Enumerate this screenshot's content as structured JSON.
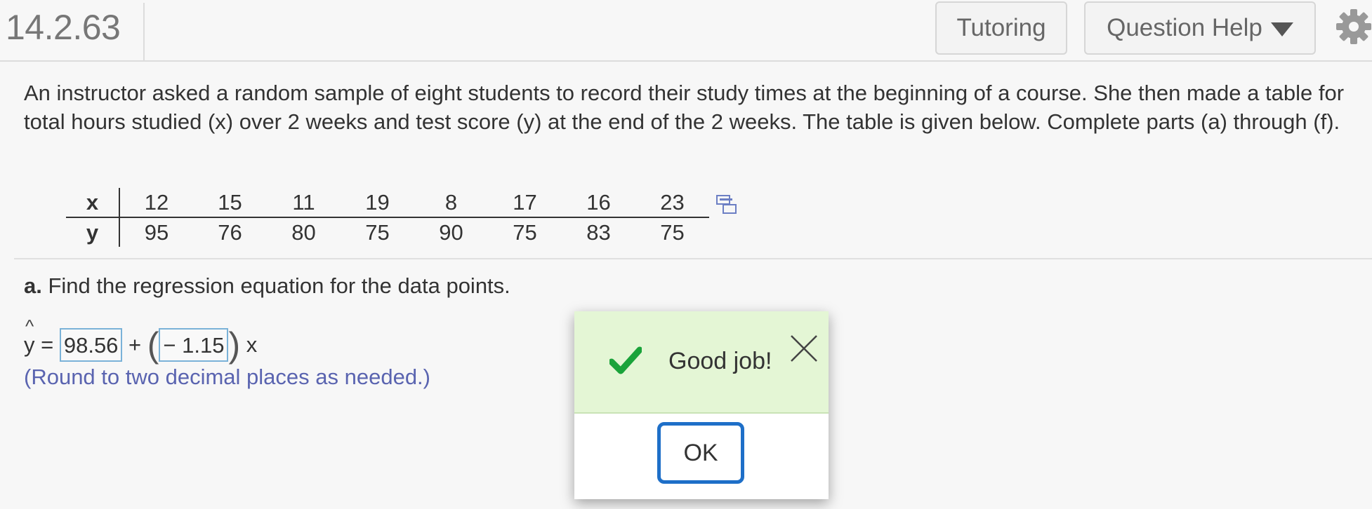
{
  "header": {
    "question_number": "14.2.63",
    "tutoring_label": "Tutoring",
    "question_help_label": "Question Help"
  },
  "problem": {
    "text": "An instructor asked a random sample of eight students to record their study times at the beginning of a course. She then made a table for total hours studied (x) over 2 weeks and test score (y) at the end of the 2 weeks. The table is given below. Complete parts (a) through (f)."
  },
  "table": {
    "x_label": "x",
    "y_label": "y",
    "x_values": [
      "12",
      "15",
      "11",
      "19",
      "8",
      "17",
      "16",
      "23"
    ],
    "y_values": [
      "95",
      "76",
      "80",
      "75",
      "90",
      "75",
      "83",
      "75"
    ]
  },
  "part_a": {
    "label": "a.",
    "prompt": " Find the regression equation for the data points.",
    "yhat_symbol": "y",
    "hat_mark": "^",
    "equals": " = ",
    "intercept": "98.56",
    "plus": " + ",
    "open_paren": "(",
    "slope": "− 1.15",
    "close_paren": ")",
    "x_var": " x",
    "hint": "(Round to two decimal places as needed.)"
  },
  "dialog": {
    "message": "Good job!",
    "ok_label": "OK"
  },
  "colors": {
    "success_bg": "#e4f6d5",
    "check_green": "#1aa33a",
    "ok_border": "#1e6fc8",
    "hint_text": "#5a64b0",
    "answer_border": "#7ab2d8"
  },
  "icons": [
    "gear-icon",
    "caret-down-icon",
    "copy-data-icon",
    "checkmark-icon",
    "close-icon"
  ]
}
